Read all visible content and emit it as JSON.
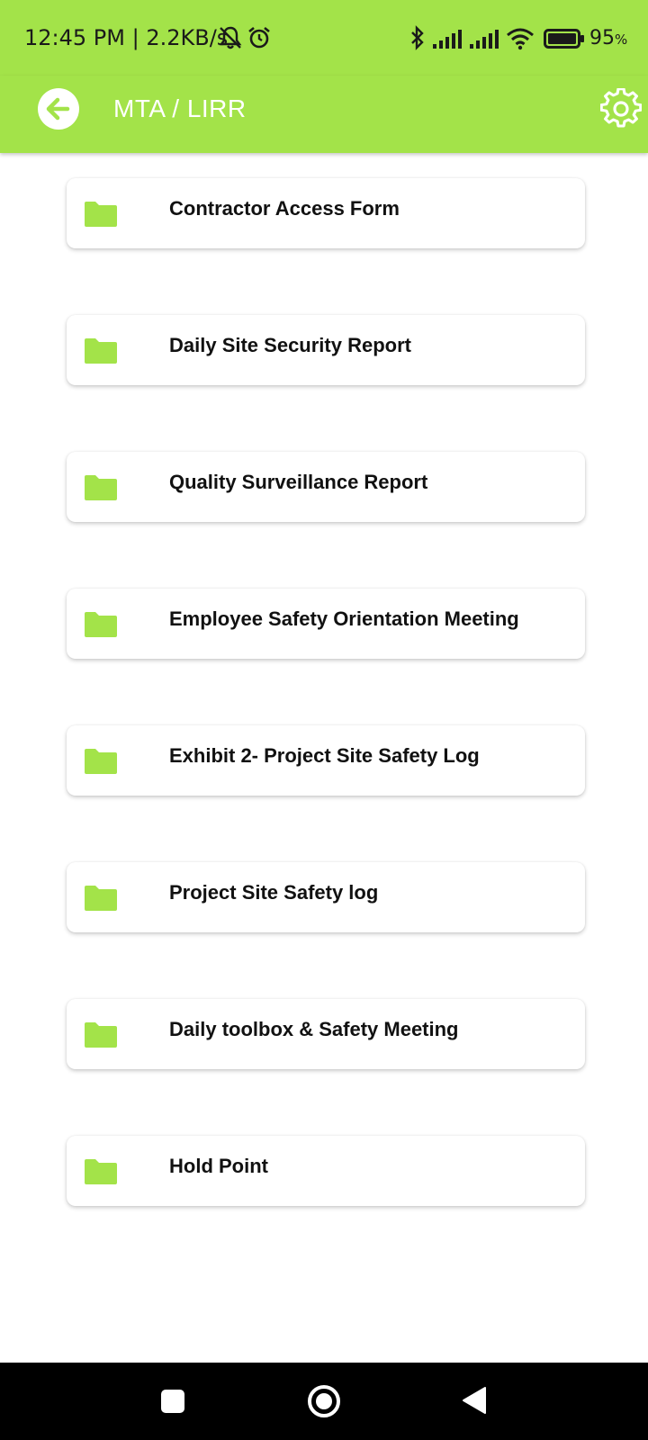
{
  "status_bar": {
    "time_speed": "12:45 PM | 2.2KB/s",
    "battery_percent": "95",
    "battery_suffix": "%",
    "icons": [
      "bell-muted-icon",
      "alarm-icon",
      "bluetooth-icon",
      "signal-icon",
      "signal-icon",
      "wifi-icon",
      "battery-icon"
    ]
  },
  "app_bar": {
    "title": "MTA / LIRR",
    "back_icon": "arrow-left-icon",
    "settings_icon": "gear-icon"
  },
  "forms": [
    {
      "label": "Contractor Access Form",
      "icon": "folder-icon"
    },
    {
      "label": "Daily Site Security Report",
      "icon": "folder-icon"
    },
    {
      "label": "Quality Surveillance Report",
      "icon": "folder-icon"
    },
    {
      "label": "Employee Safety Orientation Meeting",
      "icon": "folder-icon"
    },
    {
      "label": "Exhibit 2- Project Site Safety Log",
      "icon": "folder-icon"
    },
    {
      "label": "Project Site Safety log",
      "icon": "folder-icon"
    },
    {
      "label": "Daily toolbox & Safety Meeting",
      "icon": "folder-icon"
    },
    {
      "label": "Hold Point",
      "icon": "folder-icon"
    }
  ],
  "nav_bar": {
    "icons": [
      "recents-square-icon",
      "home-circle-icon",
      "back-triangle-icon"
    ]
  },
  "colors": {
    "accent": "#a3e349",
    "folder": "#a3e349",
    "card_bg": "#ffffff",
    "text": "#111111",
    "nav_bg": "#000000"
  }
}
